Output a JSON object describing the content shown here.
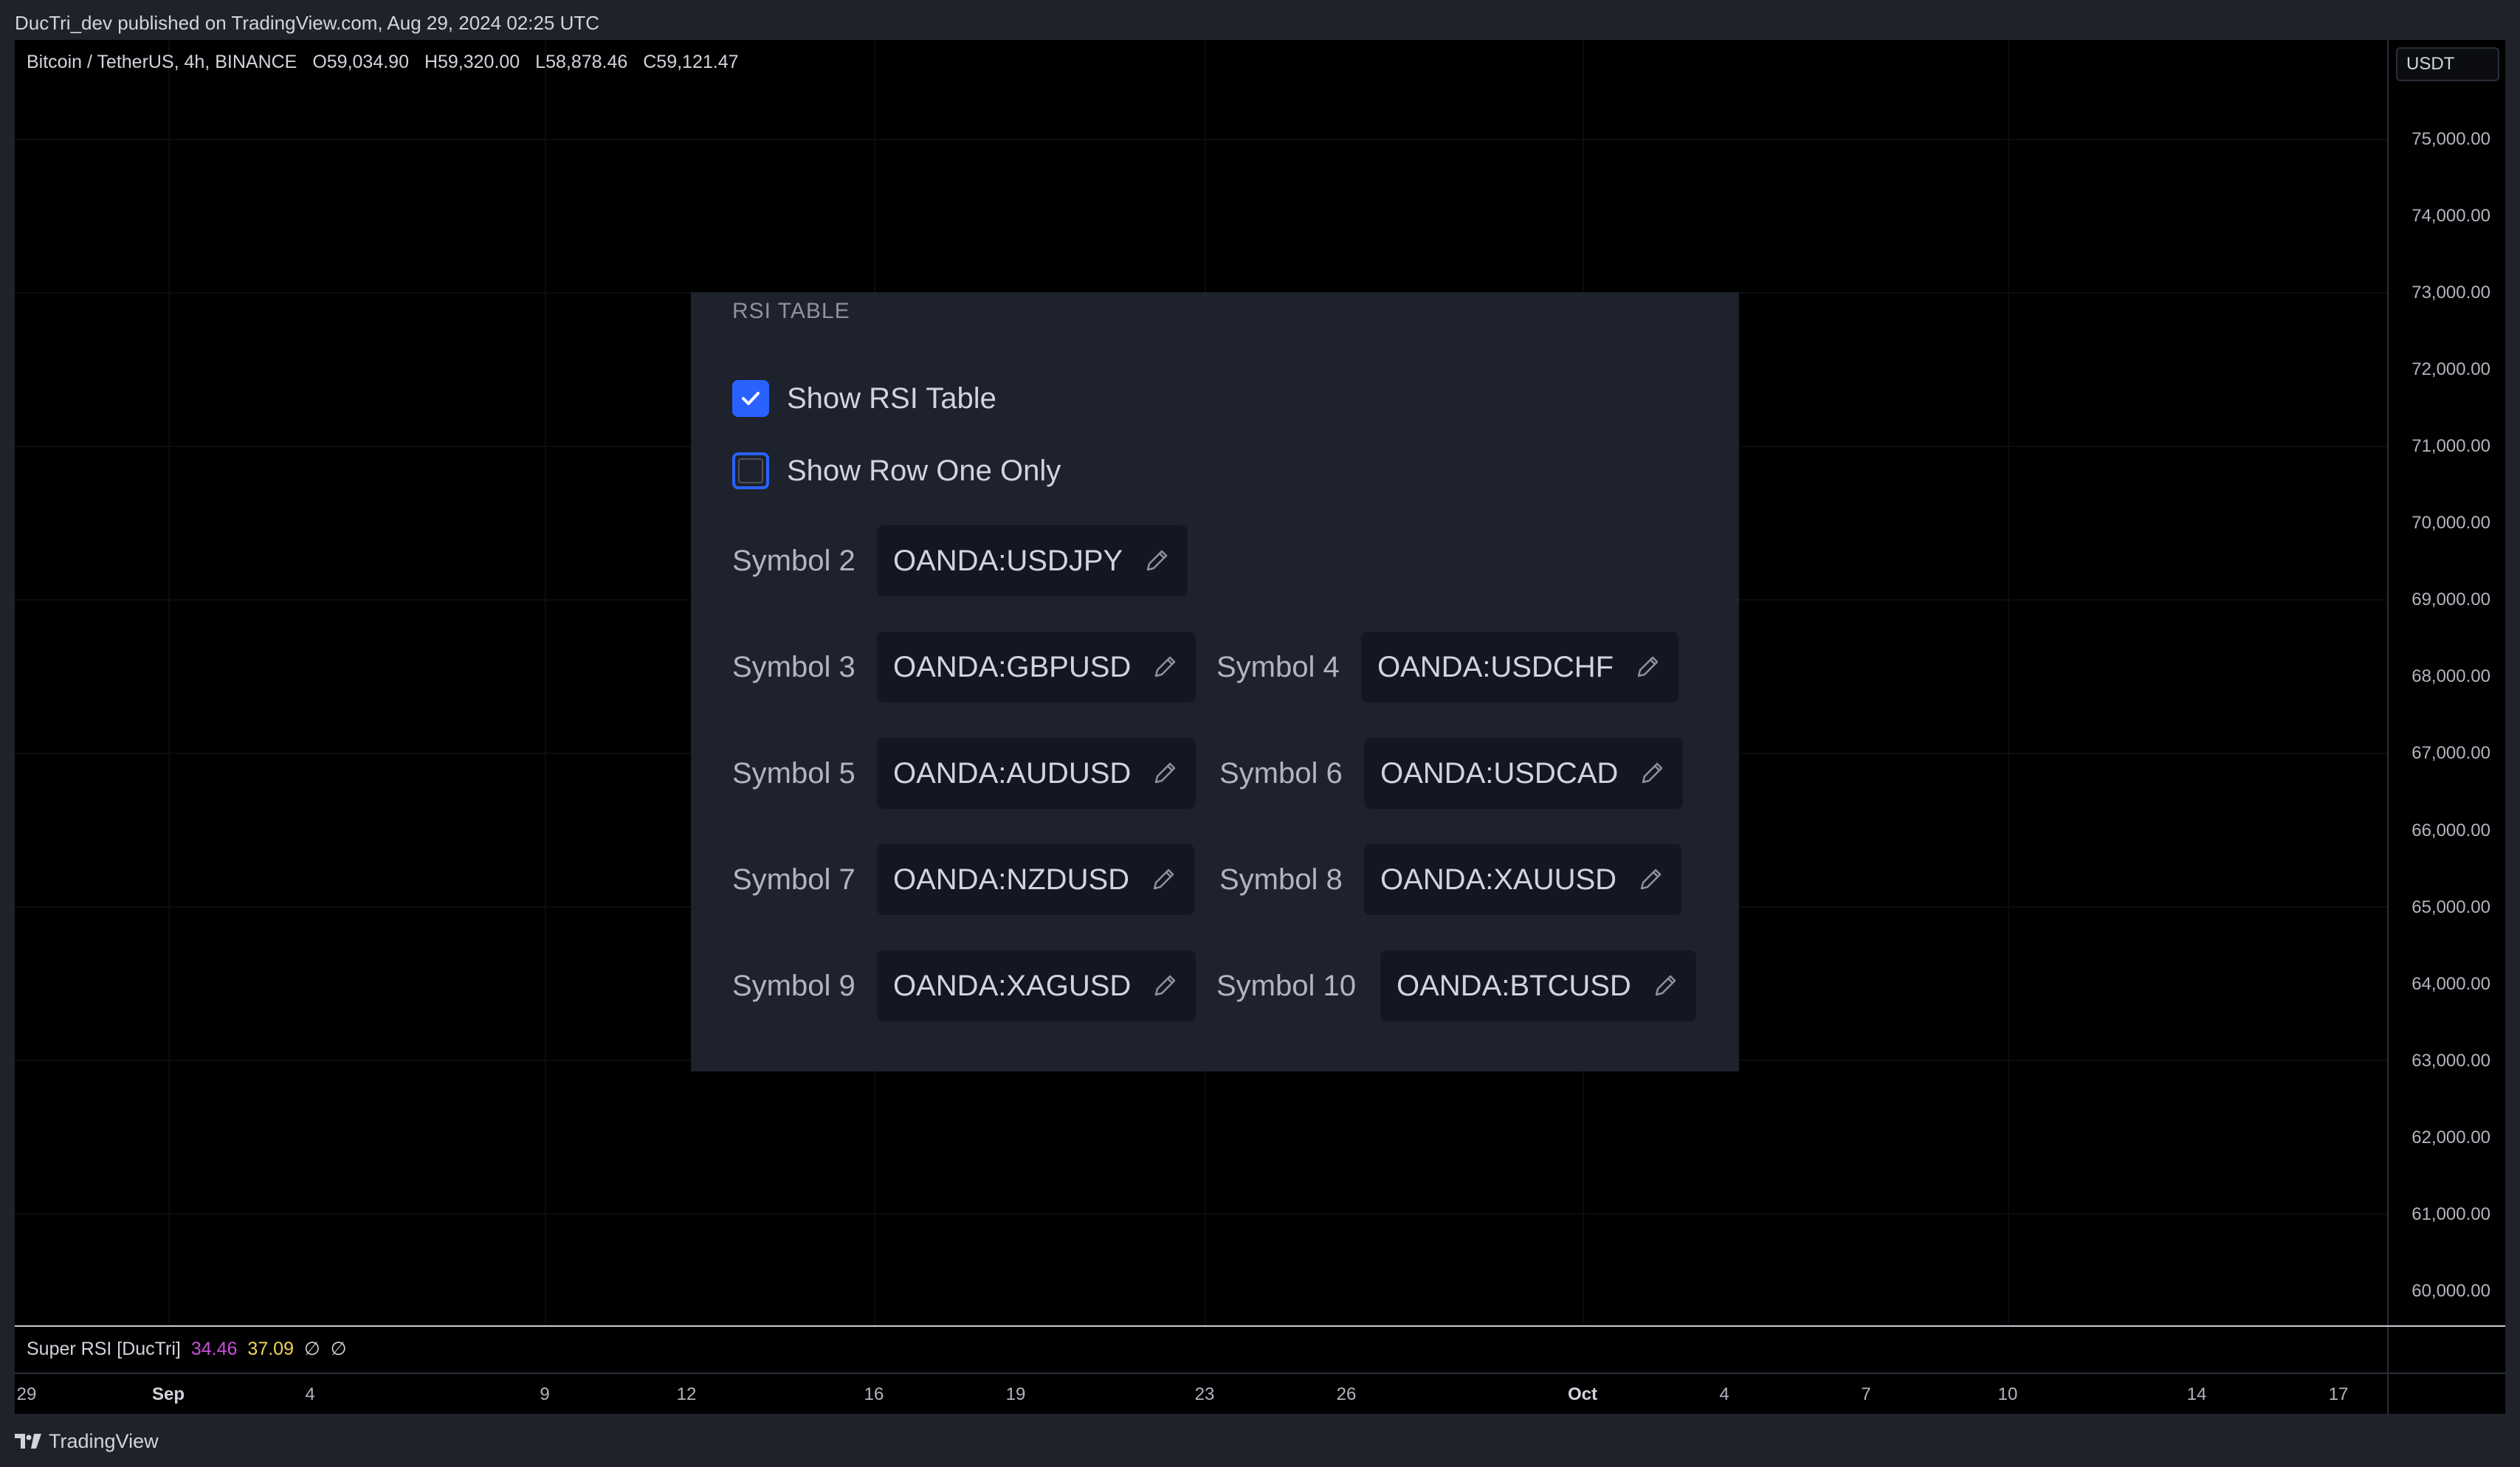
{
  "header": {
    "caption": "DucTri_dev published on TradingView.com, Aug 29, 2024 02:25 UTC"
  },
  "chart": {
    "symbol_line": "Bitcoin / TetherUS, 4h, BINANCE",
    "open": "O59,034.90",
    "high": "H59,320.00",
    "low": "L58,878.46",
    "close": "C59,121.47",
    "currency": "USDT"
  },
  "price_axis": {
    "ticks": [
      "75,000.00",
      "74,000.00",
      "73,000.00",
      "72,000.00",
      "71,000.00",
      "70,000.00",
      "69,000.00",
      "68,000.00",
      "67,000.00",
      "66,000.00",
      "65,000.00",
      "64,000.00",
      "63,000.00",
      "62,000.00",
      "61,000.00",
      "60,000.00"
    ]
  },
  "time_axis": {
    "labels": [
      "29",
      "Sep",
      "4",
      "9",
      "12",
      "16",
      "19",
      "23",
      "26",
      "Oct",
      "4",
      "7",
      "10",
      "14",
      "17"
    ]
  },
  "indicator": {
    "name": "Super RSI [DucTri]",
    "value1": "34.46",
    "value2": "37.09",
    "na1": "∅",
    "na2": "∅",
    "color1": "#c74fd8",
    "color2": "#f0d35a"
  },
  "panel": {
    "section_title": "RSI TABLE",
    "show_table": {
      "label": "Show RSI Table",
      "checked": true
    },
    "row_one_only": {
      "label": "Show Row One Only",
      "checked": false
    },
    "symbols": {
      "s2": {
        "label": "Symbol 2",
        "value": "OANDA:USDJPY"
      },
      "s3": {
        "label": "Symbol 3",
        "value": "OANDA:GBPUSD"
      },
      "s4": {
        "label": "Symbol 4",
        "value": "OANDA:USDCHF"
      },
      "s5": {
        "label": "Symbol 5",
        "value": "OANDA:AUDUSD"
      },
      "s6": {
        "label": "Symbol 6",
        "value": "OANDA:USDCAD"
      },
      "s7": {
        "label": "Symbol 7",
        "value": "OANDA:NZDUSD"
      },
      "s8": {
        "label": "Symbol 8",
        "value": "OANDA:XAUUSD"
      },
      "s9": {
        "label": "Symbol 9",
        "value": "OANDA:XAGUSD"
      },
      "s10": {
        "label": "Symbol 10",
        "value": "OANDA:BTCUSD"
      }
    }
  },
  "footer": {
    "brand": "TradingView"
  },
  "colors": {
    "accent": "#2962ff",
    "background": "#000000",
    "panel": "#1e222d"
  }
}
